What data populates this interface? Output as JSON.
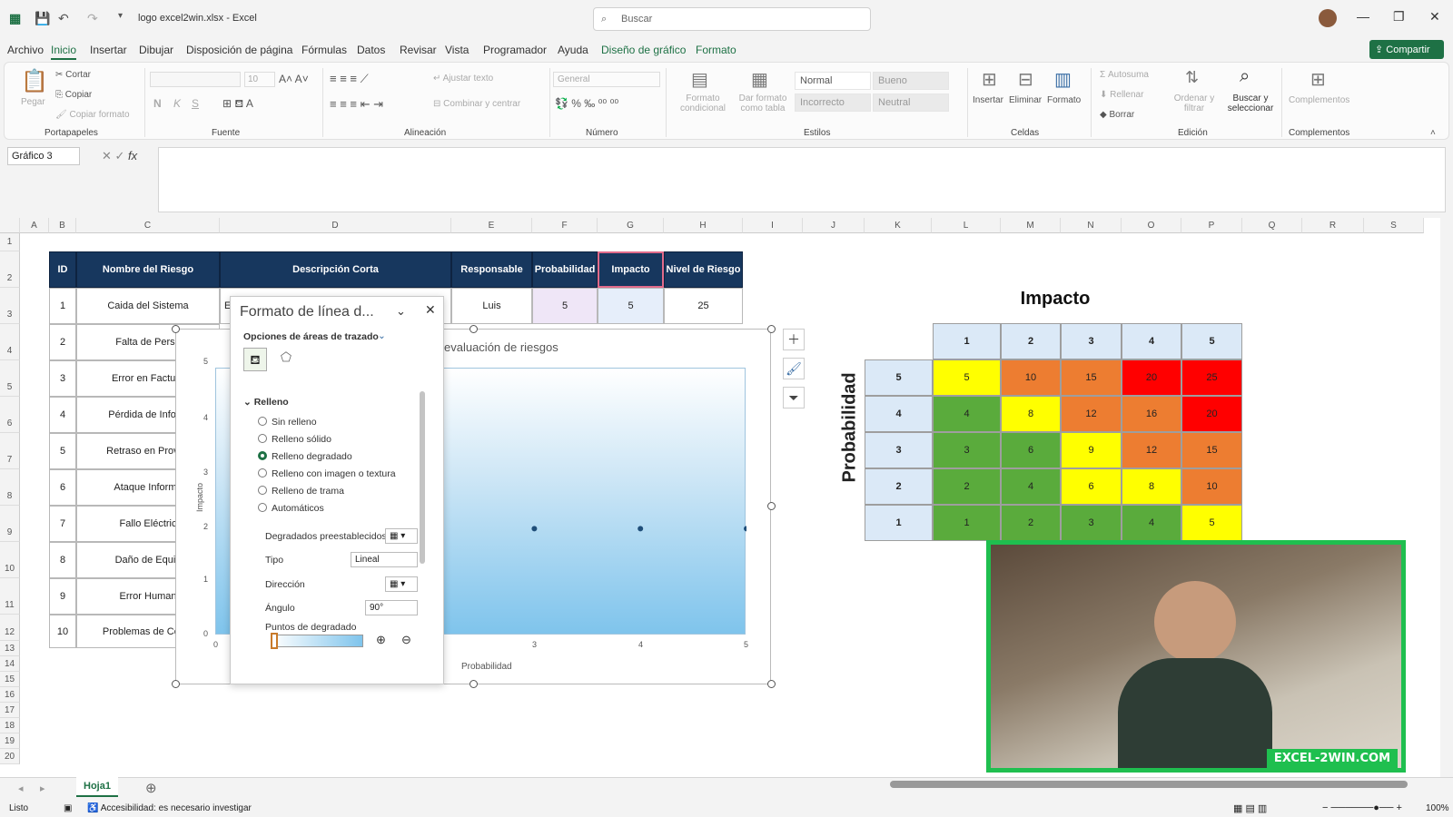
{
  "app": {
    "title": "logo excel2win.xlsx  -  Excel",
    "search_placeholder": "Buscar",
    "share_label": "Compartir"
  },
  "menu": [
    "Archivo",
    "Inicio",
    "Insertar",
    "Dibujar",
    "Disposición de página",
    "Fórmulas",
    "Datos",
    "Revisar",
    "Vista",
    "Programador",
    "Ayuda",
    "Diseño de gráfico",
    "Formato"
  ],
  "ribbon": {
    "portapapeles": {
      "label": "Portapapeles",
      "paste": "Pegar",
      "cut": "Cortar",
      "copy": "Copiar",
      "format_painter": "Copiar formato"
    },
    "fuente": {
      "label": "Fuente",
      "size": "10"
    },
    "alineacion": {
      "label": "Alineación",
      "wrap": "Ajustar texto",
      "merge": "Combinar y centrar"
    },
    "numero": {
      "label": "Número",
      "format": "General"
    },
    "estilos": {
      "label": "Estilos",
      "cond": "Formato condicional",
      "table": "Dar formato como tabla",
      "normal": "Normal",
      "bueno": "Bueno",
      "incorrecto": "Incorrecto",
      "neutral": "Neutral"
    },
    "celdas": {
      "label": "Celdas",
      "insert": "Insertar",
      "delete": "Eliminar",
      "format": "Formato"
    },
    "edicion": {
      "label": "Edición",
      "autosum": "Autosuma",
      "fill": "Rellenar",
      "clear": "Borrar",
      "sort": "Ordenar y filtrar",
      "find": "Buscar y seleccionar"
    },
    "complementos": {
      "label": "Complementos",
      "addins": "Complementos"
    }
  },
  "namebox": "Gráfico 3",
  "columns": [
    "A",
    "B",
    "C",
    "D",
    "E",
    "F",
    "G",
    "H",
    "I",
    "J",
    "K",
    "L",
    "M",
    "N",
    "O",
    "P",
    "Q",
    "R",
    "S"
  ],
  "rows": [
    "1",
    "2",
    "3",
    "4",
    "5",
    "6",
    "7",
    "8",
    "9",
    "10",
    "11",
    "12",
    "13",
    "14",
    "15",
    "16",
    "17",
    "18",
    "19",
    "20"
  ],
  "table": {
    "headers": [
      "ID",
      "Nombre del Riesgo",
      "Descripción Corta",
      "Responsable",
      "Probabilidad",
      "Impacto",
      "Nivel de Riesgo"
    ],
    "row1": {
      "id": "1",
      "name": "Caida del Sistema",
      "desc": "E",
      "resp": "Luis",
      "prob": "5",
      "imp": "5",
      "nivel": "25"
    },
    "ids": [
      "2",
      "3",
      "4",
      "5",
      "6",
      "7",
      "8",
      "9",
      "10"
    ],
    "names": [
      "Falta de Perso",
      "Error en Factura",
      "Pérdida de Inform",
      "Retraso en Provee",
      "Ataque Informá",
      "Fallo Eléctric",
      "Daño de Equip",
      "Error Human",
      "Problemas de Comu"
    ]
  },
  "chart": {
    "title": "evaluación de riesgos",
    "xlabel": "Probabilidad",
    "ylabel": "Impacto",
    "yticks": [
      "0",
      "1",
      "2",
      "3",
      "4",
      "5"
    ],
    "xticks": [
      "0",
      "3",
      "4",
      "5"
    ]
  },
  "chart_data": {
    "type": "scatter",
    "title": "evaluación de riesgos",
    "xlabel": "Probabilidad",
    "ylabel": "Impacto",
    "xlim": [
      0,
      5
    ],
    "ylim": [
      0,
      5
    ],
    "x": [
      3,
      4,
      5
    ],
    "y": [
      2,
      2,
      2
    ]
  },
  "panel": {
    "title": "Formato de línea d...",
    "options": "Opciones de áreas de trazado",
    "section": "Relleno",
    "radios": [
      "Sin relleno",
      "Relleno sólido",
      "Relleno degradado",
      "Relleno con imagen o textura",
      "Relleno de trama",
      "Automáticos"
    ],
    "preset": "Degradados preestablecidos",
    "type_label": "Tipo",
    "type_value": "Lineal",
    "direction": "Dirección",
    "angle_label": "Ángulo",
    "angle_value": "90°",
    "stops": "Puntos de degradado"
  },
  "matrix": {
    "title": "Impacto",
    "side": "Probabilidad",
    "cols": [
      "1",
      "2",
      "3",
      "4",
      "5"
    ],
    "rows": [
      "5",
      "4",
      "3",
      "2",
      "1"
    ],
    "values": [
      [
        "5",
        "10",
        "15",
        "20",
        "25"
      ],
      [
        "4",
        "8",
        "12",
        "16",
        "20"
      ],
      [
        "3",
        "6",
        "9",
        "12",
        "15"
      ],
      [
        "2",
        "4",
        "6",
        "8",
        "10"
      ],
      [
        "1",
        "2",
        "3",
        "4",
        "5"
      ]
    ],
    "colors": [
      [
        "#ffff00",
        "#ed7d31",
        "#ed7d31",
        "#ff0000",
        "#ff0000"
      ],
      [
        "#5aab3c",
        "#ffff00",
        "#ed7d31",
        "#ed7d31",
        "#ff0000"
      ],
      [
        "#5aab3c",
        "#5aab3c",
        "#ffff00",
        "#ed7d31",
        "#ed7d31"
      ],
      [
        "#5aab3c",
        "#5aab3c",
        "#ffff00",
        "#ffff00",
        "#ed7d31"
      ],
      [
        "#5aab3c",
        "#5aab3c",
        "#5aab3c",
        "#5aab3c",
        "#ffff00"
      ]
    ]
  },
  "video": {
    "logo": "EXCEL-2WIN.COM"
  },
  "sheet_tab": "Hoja1",
  "status": {
    "ready": "Listo",
    "accessibility": "Accesibilidad: es necesario investigar",
    "zoom": "100%"
  }
}
